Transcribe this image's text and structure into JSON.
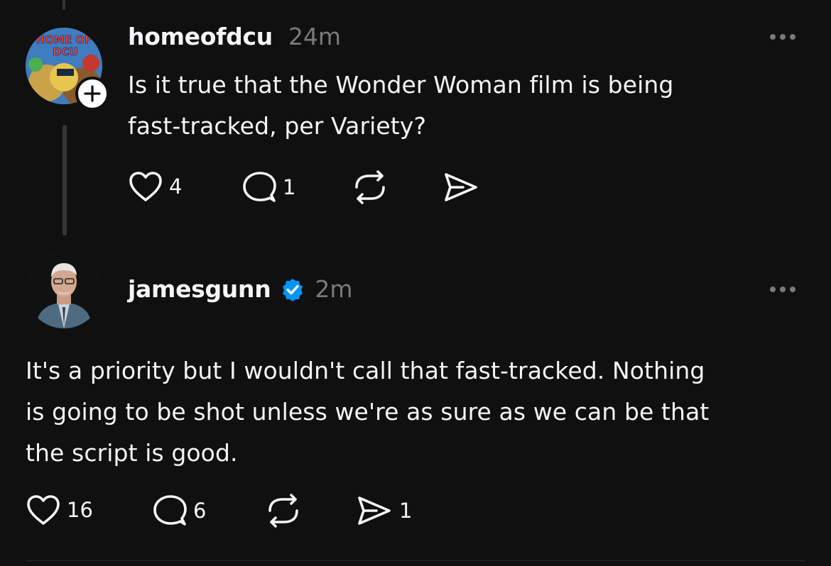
{
  "post1": {
    "username": "homeofdcu",
    "time": "24m",
    "avatar_text": [
      "HOME OF",
      "DCU"
    ],
    "text_line1": "Is it true that the Wonder Woman film is being",
    "text_line2": "fast-tracked, per Variety?",
    "likes": "4",
    "replies": "1",
    "reposts": "",
    "shares": ""
  },
  "post2": {
    "username": "jamesgunn",
    "verified": true,
    "time": "2m",
    "text_line1": "It's a priority but I wouldn't call that fast-tracked. Nothing",
    "text_line2": "is going to be shot unless we're as sure as we can be that",
    "text_line3": "the script is good.",
    "likes": "16",
    "replies": "6",
    "reposts": "",
    "shares": "1"
  },
  "icons": {
    "like": "heart-icon",
    "reply": "comment-icon",
    "repost": "repost-icon",
    "share": "send-icon",
    "more": "more-icon",
    "follow": "plus-icon",
    "verified": "verified-badge-icon"
  },
  "colors": {
    "background": "#101010",
    "text": "#f3f5f7",
    "muted": "#7a7a7a",
    "verified": "#0095f6",
    "thread_line": "#333638"
  }
}
